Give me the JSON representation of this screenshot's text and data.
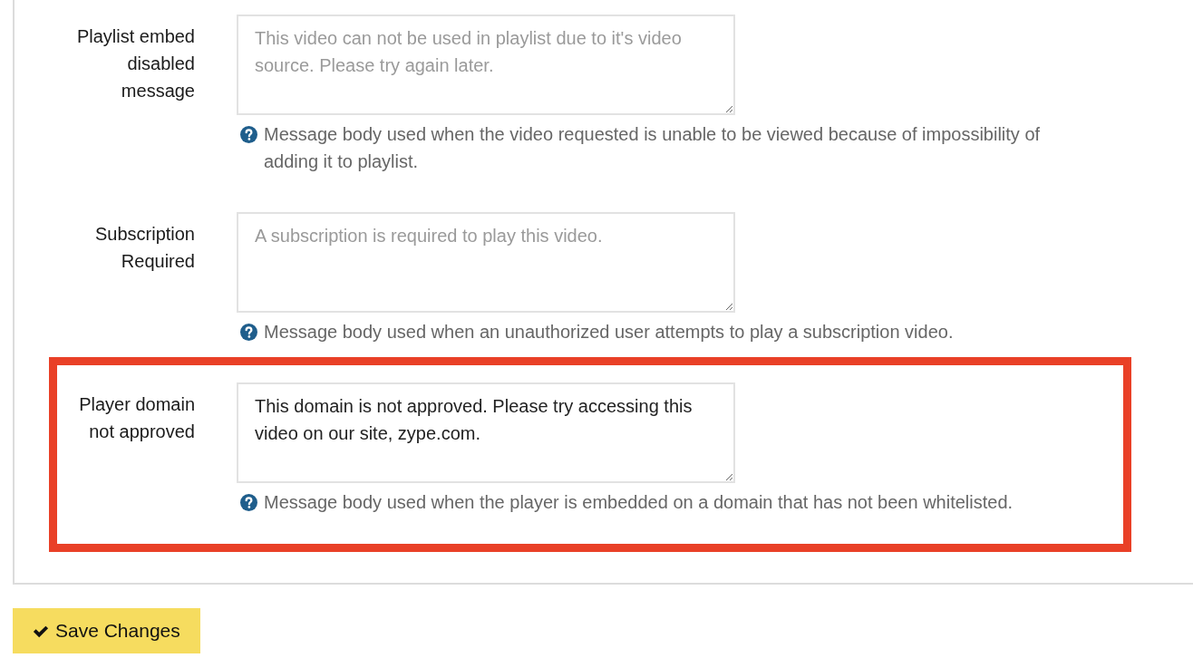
{
  "fields": [
    {
      "label": "Playlist embed disabled message",
      "placeholder": "This video can not be used in playlist due to it's video source. Please try again later.",
      "help": "Message body used when the video requested is unable to be viewed because of impossibility of adding it to playlist.",
      "highlighted": false
    },
    {
      "label": "Subscription Required",
      "placeholder": "A subscription is required to play this video.",
      "help": "Message body used when an unauthorized user attempts to play a subscription video.",
      "highlighted": false
    },
    {
      "label": "Player domain not approved",
      "value": "This domain is not approved. Please try accessing this video on our site, zype.com.",
      "help": "Message body used when the player is embedded on a domain that has not been whitelisted.",
      "highlighted": true
    }
  ],
  "save_button": "Save Changes"
}
